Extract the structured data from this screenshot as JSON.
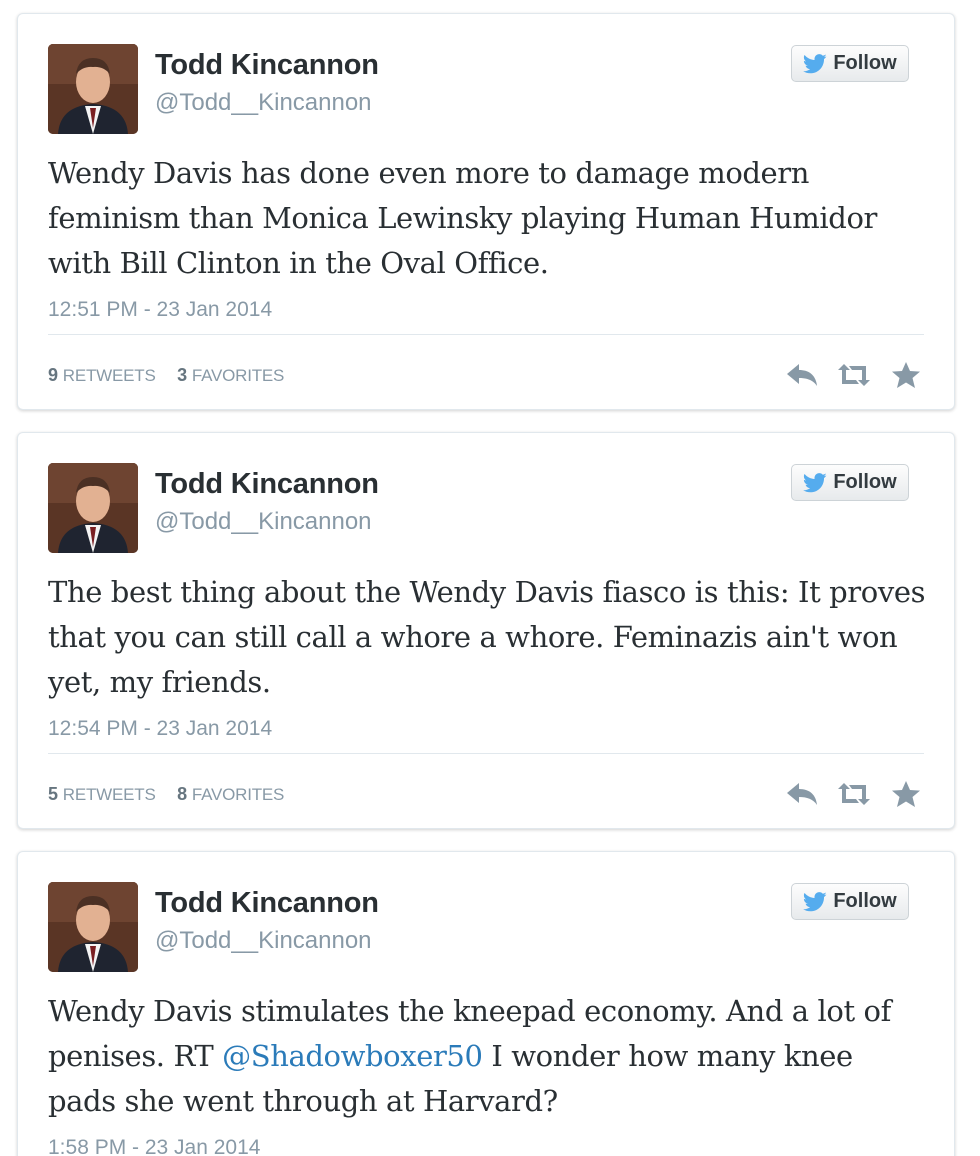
{
  "colors": {
    "text": "#292f33",
    "muted": "#8899a6",
    "link": "#2b7bb9",
    "twitter_blue": "#55acee",
    "action_gray": "#8899a6"
  },
  "tweets": [
    {
      "author_name": "Todd Kincannon",
      "screen_name": "@Todd__Kincannon",
      "follow_label": "Follow",
      "text": "Wendy Davis has done even more to damage modern feminism than Monica Lewinsky playing Human Humidor with Bill Clinton in the Oval Office.",
      "timestamp": "12:51 PM - 23 Jan 2014",
      "retweets_count": "9",
      "retweets_label": "Retweets",
      "favorites_count": "3",
      "favorites_label": "Favorites",
      "icons": [
        "bird-icon",
        "reply-icon",
        "retweet-icon",
        "favorite-star-icon"
      ]
    },
    {
      "author_name": "Todd Kincannon",
      "screen_name": "@Todd__Kincannon",
      "follow_label": "Follow",
      "text": "The best thing about the Wendy Davis fiasco is this: It proves that you can still call a whore a whore. Feminazis ain't won yet, my friends.",
      "timestamp": "12:54 PM - 23 Jan 2014",
      "retweets_count": "5",
      "retweets_label": "Retweets",
      "favorites_count": "8",
      "favorites_label": "Favorites",
      "icons": [
        "bird-icon",
        "reply-icon",
        "retweet-icon",
        "favorite-star-icon"
      ]
    },
    {
      "author_name": "Todd Kincannon",
      "screen_name": "@Todd__Kincannon",
      "follow_label": "Follow",
      "text_before": "Wendy Davis stimulates the kneepad economy. And a lot of penises. RT ",
      "mention": "@Shadowboxer50",
      "text_after": " I wonder how many knee pads she went through at Harvard?",
      "timestamp": "1:58 PM - 23 Jan 2014",
      "icons": [
        "bird-icon"
      ]
    }
  ]
}
